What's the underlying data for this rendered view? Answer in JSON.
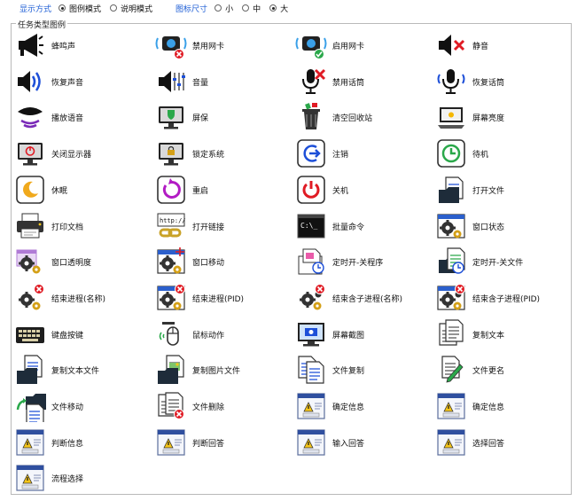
{
  "display_mode": {
    "label": "显示方式",
    "options": [
      {
        "label": "图例模式",
        "selected": true
      },
      {
        "label": "说明模式",
        "selected": false
      }
    ]
  },
  "icon_size": {
    "label": "图标尺寸",
    "options": [
      {
        "label": "小",
        "selected": false
      },
      {
        "label": "中",
        "selected": false
      },
      {
        "label": "大",
        "selected": true
      }
    ]
  },
  "group_title": "任务类型图例",
  "items": [
    {
      "label": "蜂鸣声",
      "icon": "beep-icon"
    },
    {
      "label": "禁用网卡",
      "icon": "disable-nic-icon"
    },
    {
      "label": "启用网卡",
      "icon": "enable-nic-icon"
    },
    {
      "label": "静音",
      "icon": "mute-icon"
    },
    {
      "label": "恢复声音",
      "icon": "restore-sound-icon"
    },
    {
      "label": "音量",
      "icon": "volume-icon"
    },
    {
      "label": "禁用话筒",
      "icon": "disable-mic-icon"
    },
    {
      "label": "恢复话筒",
      "icon": "restore-mic-icon"
    },
    {
      "label": "播放语音",
      "icon": "play-voice-icon"
    },
    {
      "label": "屏保",
      "icon": "screensaver-icon"
    },
    {
      "label": "清空回收站",
      "icon": "empty-recycle-bin-icon"
    },
    {
      "label": "屏幕亮度",
      "icon": "screen-brightness-icon"
    },
    {
      "label": "关闭显示器",
      "icon": "monitor-off-icon"
    },
    {
      "label": "锁定系统",
      "icon": "lock-system-icon"
    },
    {
      "label": "注销",
      "icon": "logoff-icon"
    },
    {
      "label": "待机",
      "icon": "standby-icon"
    },
    {
      "label": "休眠",
      "icon": "hibernate-icon"
    },
    {
      "label": "重启",
      "icon": "restart-icon"
    },
    {
      "label": "关机",
      "icon": "shutdown-icon"
    },
    {
      "label": "打开文件",
      "icon": "open-file-icon"
    },
    {
      "label": "打印文档",
      "icon": "print-document-icon"
    },
    {
      "label": "打开链接",
      "icon": "open-link-icon"
    },
    {
      "label": "批量命令",
      "icon": "batch-command-icon"
    },
    {
      "label": "窗口状态",
      "icon": "window-state-icon"
    },
    {
      "label": "窗口透明度",
      "icon": "window-transparency-icon"
    },
    {
      "label": "窗口移动",
      "icon": "window-move-icon"
    },
    {
      "label": "定时开-关程序",
      "icon": "timed-program-icon"
    },
    {
      "label": "定时开-关文件",
      "icon": "timed-file-icon"
    },
    {
      "label": "结束进程(名称)",
      "icon": "kill-process-name-icon"
    },
    {
      "label": "结束进程(PID)",
      "icon": "kill-process-pid-icon"
    },
    {
      "label": "结束含子进程(名称)",
      "icon": "kill-process-tree-name-icon"
    },
    {
      "label": "结束含子进程(PID)",
      "icon": "kill-process-tree-pid-icon"
    },
    {
      "label": "键盘按键",
      "icon": "keyboard-icon"
    },
    {
      "label": "鼠标动作",
      "icon": "mouse-action-icon"
    },
    {
      "label": "屏幕截图",
      "icon": "screenshot-icon"
    },
    {
      "label": "复制文本",
      "icon": "copy-text-icon"
    },
    {
      "label": "复制文本文件",
      "icon": "copy-text-file-icon"
    },
    {
      "label": "复制图片文件",
      "icon": "copy-image-file-icon"
    },
    {
      "label": "文件复制",
      "icon": "file-copy-icon"
    },
    {
      "label": "文件更名",
      "icon": "file-rename-icon"
    },
    {
      "label": "文件移动",
      "icon": "file-move-icon"
    },
    {
      "label": "文件删除",
      "icon": "file-delete-icon"
    },
    {
      "label": "确定信息",
      "icon": "confirm-message-icon"
    },
    {
      "label": "确定信息",
      "icon": "confirm-message-icon"
    },
    {
      "label": "判断信息",
      "icon": "judge-message-icon"
    },
    {
      "label": "判断回答",
      "icon": "judge-answer-icon"
    },
    {
      "label": "输入回答",
      "icon": "input-answer-icon"
    },
    {
      "label": "选择回答",
      "icon": "choose-answer-icon"
    },
    {
      "label": "流程选择",
      "icon": "process-choice-icon"
    }
  ]
}
